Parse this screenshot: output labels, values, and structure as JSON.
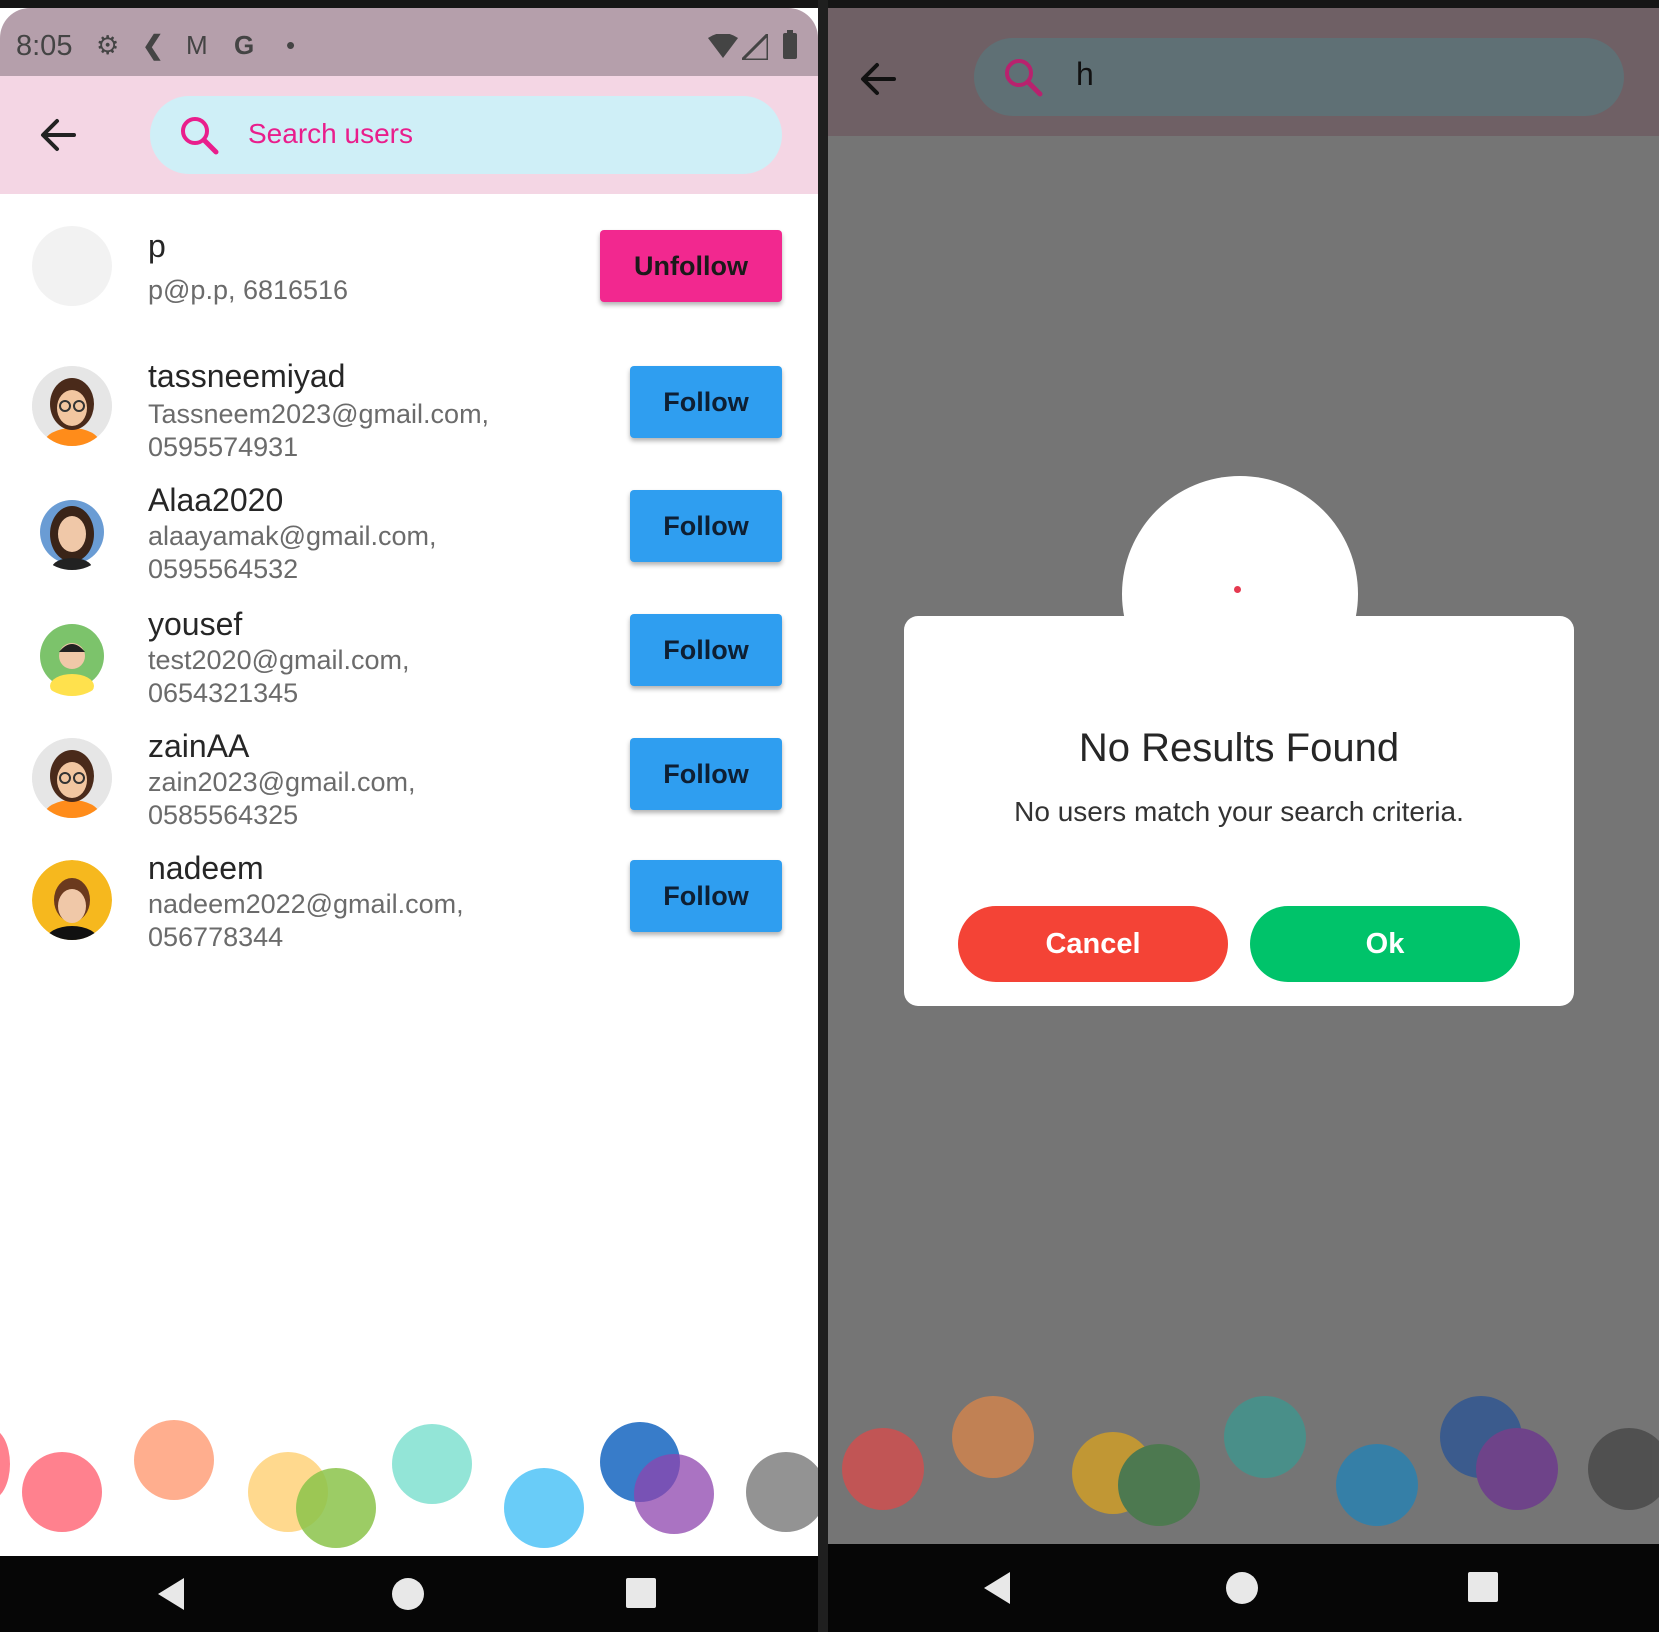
{
  "left_screen": {
    "status_bar": {
      "time": "8:05",
      "icons": [
        "gear-icon",
        "flutter-icon",
        "gmail-icon",
        "google-icon",
        "dot-icon",
        "wifi-icon",
        "signal-icon",
        "battery-icon"
      ]
    },
    "search": {
      "placeholder": "Search users"
    },
    "users": [
      {
        "name": "p",
        "email": "p@p.p, 6816516",
        "phone": "",
        "button": "Unfollow",
        "following": true,
        "avatar": "blank-avatar"
      },
      {
        "name": "tassneemiyad",
        "email": "Tassneem2023@gmail.com,",
        "phone": "0595574931",
        "button": "Follow",
        "following": false,
        "avatar": "woman-glasses-avatar"
      },
      {
        "name": "Alaa2020",
        "email": "alaayamak@gmail.com,",
        "phone": "0595564532",
        "button": "Follow",
        "following": false,
        "avatar": "woman-blue-avatar"
      },
      {
        "name": "yousef",
        "email": "test2020@gmail.com,",
        "phone": "0654321345",
        "button": "Follow",
        "following": false,
        "avatar": "boy-green-avatar"
      },
      {
        "name": "zainAA",
        "email": "zain2023@gmail.com,",
        "phone": "0585564325",
        "button": "Follow",
        "following": false,
        "avatar": "woman-glasses-avatar"
      },
      {
        "name": "nadeem",
        "email": "nadeem2022@gmail.com,",
        "phone": "056778344",
        "button": "Follow",
        "following": false,
        "avatar": "man-orange-avatar"
      }
    ]
  },
  "right_screen": {
    "search": {
      "value": "h"
    },
    "dialog": {
      "title": "No Results Found",
      "message": "No users match your search criteria.",
      "cancel_label": "Cancel",
      "ok_label": "Ok"
    }
  },
  "colors": {
    "follow": "#2f9ef0",
    "unfollow": "#f2288f",
    "cancel": "#f44336",
    "ok": "#00c36a",
    "search_accent": "#e91e8c",
    "appbar": "#f4d6e4"
  },
  "decoration_dots": [
    "#ff6b7a",
    "#ffa07a",
    "#ffd27a",
    "#8bc34a",
    "#80e0d0",
    "#4fc3f7",
    "#1565c0",
    "#8e44ad",
    "#808080"
  ]
}
